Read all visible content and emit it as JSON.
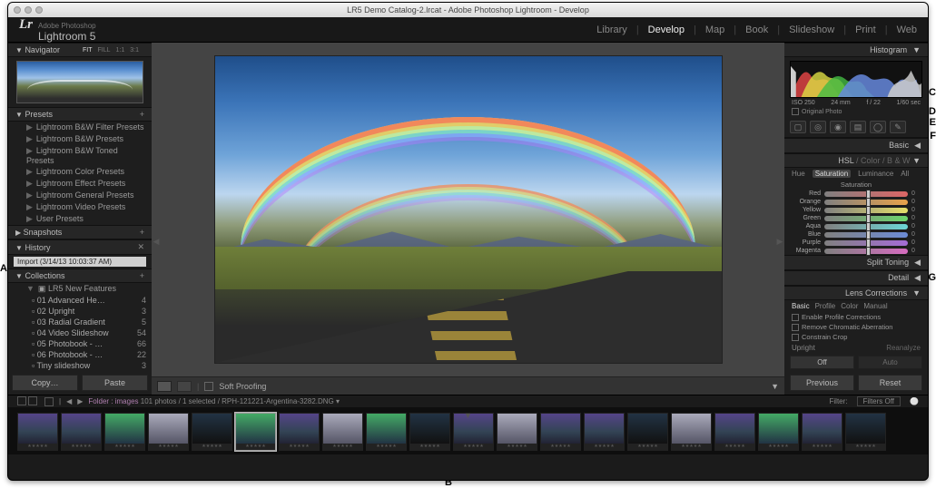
{
  "window_title": "LR5 Demo Catalog-2.lrcat - Adobe Photoshop Lightroom - Develop",
  "brand": {
    "lr": "Lr",
    "tagline": "Adobe Photoshop",
    "product": "Lightroom 5"
  },
  "modules": [
    "Library",
    "Develop",
    "Map",
    "Book",
    "Slideshow",
    "Print",
    "Web"
  ],
  "active_module": "Develop",
  "navigator": {
    "title": "Navigator",
    "opts": [
      "FIT",
      "FILL",
      "1:1",
      "3:1"
    ]
  },
  "presets": {
    "title": "Presets",
    "groups": [
      "Lightroom B&W Filter Presets",
      "Lightroom B&W Presets",
      "Lightroom B&W Toned Presets",
      "Lightroom Color Presets",
      "Lightroom Effect Presets",
      "Lightroom General Presets",
      "Lightroom Video Presets",
      "User Presets"
    ]
  },
  "snapshots": {
    "title": "Snapshots"
  },
  "history": {
    "title": "History",
    "entry": "Import (3/14/13 10:03:37 AM)"
  },
  "collections": {
    "title": "Collections",
    "set": "LR5 New Features",
    "items": [
      {
        "name": "01 Advanced He…",
        "count": 4
      },
      {
        "name": "02 Upright",
        "count": 3
      },
      {
        "name": "03 Radial Gradient",
        "count": 5
      },
      {
        "name": "04 Video Slideshow",
        "count": 54
      },
      {
        "name": "05 Photobook - …",
        "count": 66
      },
      {
        "name": "06 Photobook - …",
        "count": 22
      },
      {
        "name": "Tiny slideshow",
        "count": 3
      }
    ]
  },
  "left_buttons": {
    "copy": "Copy…",
    "paste": "Paste"
  },
  "toolbar": {
    "softproof": "Soft Proofing"
  },
  "right_buttons": {
    "prev": "Previous",
    "reset": "Reset"
  },
  "histogram": {
    "title": "Histogram",
    "exif": {
      "iso": "ISO 250",
      "focal": "24 mm",
      "aperture": "f / 22",
      "shutter": "1/60 sec"
    },
    "original": "Original Photo"
  },
  "basic_title": "Basic",
  "hsl": {
    "title": {
      "hsl": "HSL",
      "color": "Color",
      "bw": "B & W"
    },
    "tabs": [
      "Hue",
      "Saturation",
      "Luminance",
      "All"
    ],
    "active_tab": "Saturation",
    "section": "Saturation",
    "rows": [
      {
        "name": "Red",
        "grad": "linear-gradient(90deg,#808080,#d66)",
        "v": 0
      },
      {
        "name": "Orange",
        "grad": "linear-gradient(90deg,#808080,#e8a24a)",
        "v": 0
      },
      {
        "name": "Yellow",
        "grad": "linear-gradient(90deg,#808080,#e6e06a)",
        "v": 0
      },
      {
        "name": "Green",
        "grad": "linear-gradient(90deg,#808080,#6cd66c)",
        "v": 0
      },
      {
        "name": "Aqua",
        "grad": "linear-gradient(90deg,#808080,#6cd6d6)",
        "v": 0
      },
      {
        "name": "Blue",
        "grad": "linear-gradient(90deg,#808080,#6c8cd6)",
        "v": 0
      },
      {
        "name": "Purple",
        "grad": "linear-gradient(90deg,#808080,#a56cd6)",
        "v": 0
      },
      {
        "name": "Magenta",
        "grad": "linear-gradient(90deg,#808080,#d66cc0)",
        "v": 0
      }
    ]
  },
  "split_title": "Split Toning",
  "detail_title": "Detail",
  "lens": {
    "title": "Lens Corrections",
    "tabs": [
      "Basic",
      "Profile",
      "Color",
      "Manual"
    ],
    "opts": [
      "Enable Profile Corrections",
      "Remove Chromatic Aberration",
      "Constrain Crop"
    ],
    "upright": "Upright",
    "reanalyze": "Reanalyze",
    "off": "Off",
    "auto": "Auto"
  },
  "filmbar": {
    "crumb": "Folder : images ",
    "extra": "101 photos / 1 selected / RPH-121221-Argentina-3282.DNG ▾",
    "filter": "Filter:",
    "filters_off": "Filters Off"
  },
  "filmstrip_count": 20,
  "selected_thumb_index": 5,
  "callouts": {
    "A": "A",
    "B": "B",
    "C": "C",
    "D": "D",
    "E": "E",
    "F": "F",
    "G": "G"
  }
}
